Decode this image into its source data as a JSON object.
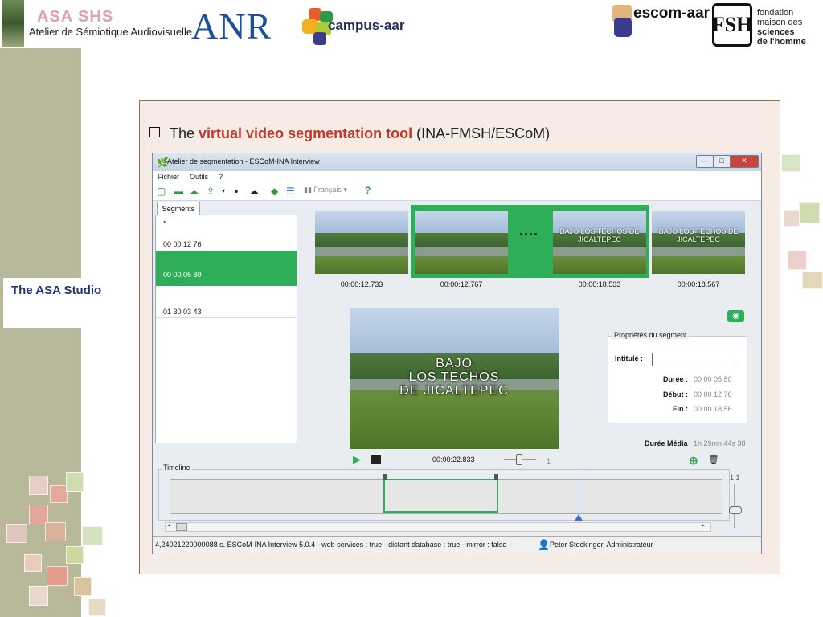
{
  "header": {
    "asa_logo_ghost": "ASA SHS",
    "asa_name": "Atelier de Sémiotique Audiovisuelle",
    "anr_logo": "ANR",
    "campus_logo": "campus-aar",
    "escom_logo": "escom-aar",
    "fmsh_mark": "FSH",
    "fmsh_lines": [
      "fondation",
      "maison des",
      "sciences",
      "de l'homme"
    ]
  },
  "sidebar": {
    "studio_label": "The ASA Studio"
  },
  "slide": {
    "heading_prefix": "The ",
    "heading_highlight": "virtual video segmentation tool",
    "heading_suffix": " (INA-FMSH/ESCoM)"
  },
  "app": {
    "window_title": "Atelier de segmentation - ESCoM-INA Interview",
    "window_buttons": {
      "minimize": "—",
      "maximize": "□",
      "close": "✕"
    },
    "menu": [
      "Fichier",
      "Outils",
      "?"
    ],
    "toolbar": {
      "language": "Français",
      "help": "?"
    },
    "segments_tab": "Segments",
    "segments": [
      {
        "label": "*",
        "selected": false
      },
      {
        "label": "00 00 12 76",
        "selected": false
      },
      {
        "label": "00 00 05 80",
        "selected": true
      },
      {
        "label": "01 30 03 43",
        "selected": false
      }
    ],
    "thumbnails": [
      {
        "time": "00:00:12.733",
        "overlay": ""
      },
      {
        "time": "00:00:12.767",
        "overlay": ""
      },
      {
        "time": "00:00:18.533",
        "overlay": "BAJO LOS TECHOS DE JICALTEPEC"
      },
      {
        "time": "00:00:18.567",
        "overlay": "BAJO LOS TECHOS DE JICALTEPEC"
      }
    ],
    "ellipsis": "....",
    "video_overlay": [
      "BAJO",
      "LOS TECHOS",
      "DE JICALTEPEC"
    ],
    "properties": {
      "title": "Propriétés du segment",
      "intitule_label": "Intitulé :",
      "intitule_value": "",
      "duree_label": "Durée :",
      "duree_value": "00 00 05 80",
      "debut_label": "Début :",
      "debut_value": "00 00 12 76",
      "fin_label": "Fin :",
      "fin_value": "00 00 18 56"
    },
    "duree_media_label": "Durée Média",
    "duree_media_value": "1h 29mn 44s 38",
    "player": {
      "time": "00:00:22.833",
      "speed": "1"
    },
    "timeline": {
      "label": "Timeline",
      "zoom": "1:1"
    },
    "status": {
      "text": "4,24021220000088 s.  ESCoM-INA Interview 5.0.4  -  web services : true - distant database : true - mirror : false -",
      "user": "Peter Stockinger, Administrateur"
    }
  },
  "colors": {
    "accent_green": "#2fae5a",
    "heading_red": "#c0392b",
    "sidebar_olive": "#b8b99a",
    "studio_blue": "#1f3a6e",
    "panel_pink": "#f7ebe6"
  },
  "icons": [
    "new-file-icon",
    "open-folder-icon",
    "cloud-open-icon",
    "export-icon",
    "save-icon",
    "cloud-save-icon",
    "tag-icon",
    "list-icon",
    "camera-icon",
    "play-icon",
    "stop-icon",
    "add-icon",
    "trash-icon",
    "user-icon"
  ]
}
